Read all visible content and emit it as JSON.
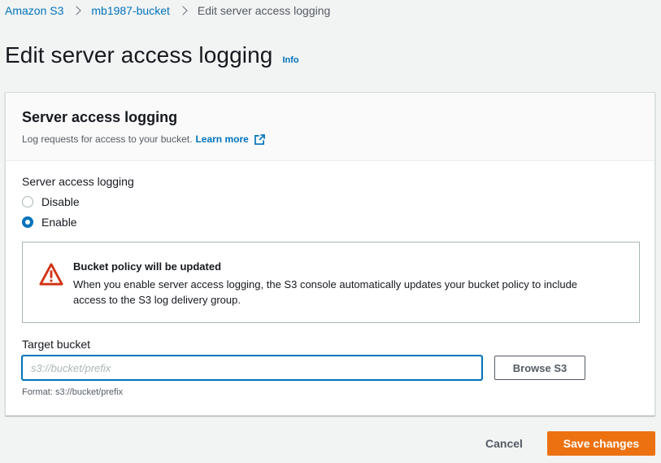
{
  "breadcrumb": {
    "items": [
      {
        "label": "Amazon S3"
      },
      {
        "label": "mb1987-bucket"
      },
      {
        "label": "Edit server access logging"
      }
    ]
  },
  "page": {
    "title": "Edit server access logging",
    "info_label": "Info"
  },
  "panel": {
    "title": "Server access logging",
    "description": "Log requests for access to your bucket.",
    "learn_more": "Learn more",
    "logging_field_label": "Server access logging",
    "options": [
      {
        "label": "Disable",
        "checked": false
      },
      {
        "label": "Enable",
        "checked": true
      }
    ],
    "alert": {
      "title": "Bucket policy will be updated",
      "body": "When you enable server access logging, the S3 console automatically updates your bucket policy to include access to the S3 log delivery group."
    },
    "target_bucket": {
      "label": "Target bucket",
      "placeholder": "s3://bucket/prefix",
      "value": "",
      "browse_label": "Browse S3",
      "help": "Format: s3://bucket/prefix"
    }
  },
  "footer": {
    "cancel_label": "Cancel",
    "save_label": "Save changes"
  },
  "colors": {
    "link": "#0073bb",
    "primary_button": "#ec7211",
    "warning_icon": "#d13212",
    "background": "#f2f3f3"
  },
  "icons": {
    "breadcrumb_separator": "chevron-right-icon",
    "external_link": "external-link-icon",
    "alert": "warning-icon"
  }
}
